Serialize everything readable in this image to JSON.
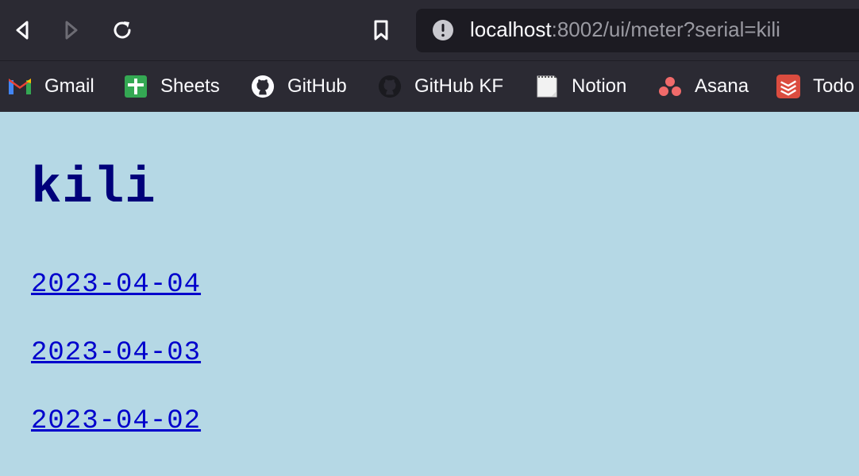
{
  "browser": {
    "url_host": "localhost",
    "url_rest": ":8002/ui/meter?serial=kili"
  },
  "bookmarks": [
    {
      "label": "Gmail",
      "icon": "gmail-icon"
    },
    {
      "label": "Sheets",
      "icon": "sheets-icon"
    },
    {
      "label": "GitHub",
      "icon": "github-icon"
    },
    {
      "label": "GitHub KF",
      "icon": "github-icon"
    },
    {
      "label": "Notion",
      "icon": "notion-icon"
    },
    {
      "label": "Asana",
      "icon": "asana-icon"
    },
    {
      "label": "Todo",
      "icon": "todoist-icon"
    }
  ],
  "page": {
    "title": "kili",
    "dates": [
      "2023-04-04",
      "2023-04-03",
      "2023-04-02"
    ]
  },
  "colors": {
    "background": "#b5d8e5",
    "title": "#00007a",
    "link": "#0000cc",
    "toolbar": "#2b2a33"
  }
}
